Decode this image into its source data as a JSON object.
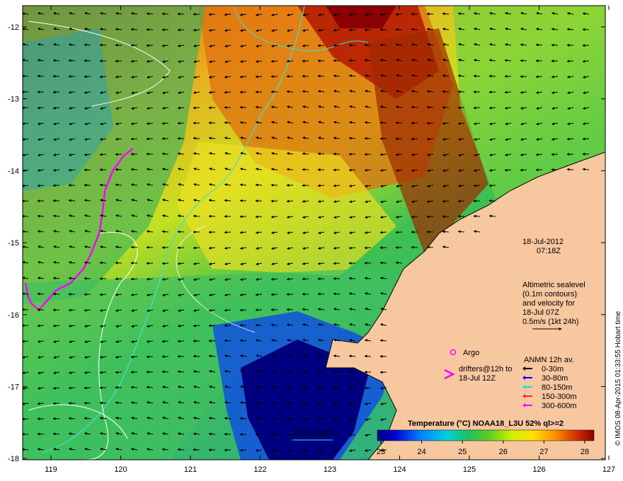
{
  "map": {
    "lon_ticks": [
      "119",
      "120",
      "121",
      "122",
      "123",
      "124",
      "125",
      "126",
      "127"
    ],
    "lat_ticks": [
      "-12",
      "-13",
      "-14",
      "-15",
      "-16",
      "-17",
      "-18"
    ]
  },
  "date": "18-Jul-2012",
  "time": "07:18Z",
  "altimetry_note": [
    "Altimetric sealevel",
    "(0.1m contours)",
    "and velocity for",
    "18-Jul 07Z",
    "0.5m/s (1kt 24h)"
  ],
  "argo_label": "Argo",
  "drifters_label": [
    "drifters@12h to",
    "18-Jul 12Z"
  ],
  "anmn": {
    "title": "ANMN 12h av.",
    "items": [
      {
        "label": "0-30m",
        "color": "#000000"
      },
      {
        "label": "30-80m",
        "color": "#0000ff"
      },
      {
        "label": "80-150m",
        "color": "#00e5e5"
      },
      {
        "label": "150-300m",
        "color": "#ff2020"
      },
      {
        "label": "300-600m",
        "color": "#ff00ff"
      }
    ]
  },
  "colorbar": {
    "title": "Temperature (°C) NOAA18_L3U 52% ql>=2",
    "ticks": [
      "23",
      "24",
      "25",
      "26",
      "27",
      "28"
    ]
  },
  "depth_scale": "200  1000m",
  "credit": "© IMOS 08-Apr-2015 01:33:55 Hobart time",
  "colors": {
    "land": "#f7c7a0",
    "contour_200": "#40e0d0",
    "contour_1000": "#ffffff",
    "drifter_track": "#ff00ff"
  }
}
